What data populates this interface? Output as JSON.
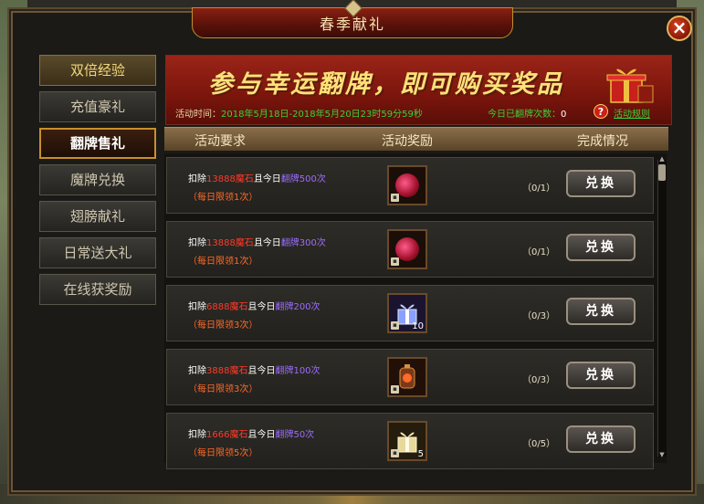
{
  "window": {
    "title": "春季献礼"
  },
  "sidebar": {
    "items": [
      {
        "label": "双倍经验",
        "style": "gold"
      },
      {
        "label": "充值豪礼",
        "style": "normal"
      },
      {
        "label": "翻牌售礼",
        "style": "active"
      },
      {
        "label": "魔牌兑换",
        "style": "normal"
      },
      {
        "label": "翅膀献礼",
        "style": "normal"
      },
      {
        "label": "日常送大礼",
        "style": "normal"
      },
      {
        "label": "在线获奖励",
        "style": "normal"
      }
    ]
  },
  "banner": {
    "title": "参与幸运翻牌，即可购买奖品",
    "time_label": "活动时间：",
    "time_value": "2018年5月18日-2018年5月20日23时59分59秒",
    "flip_label": "今日已翻牌次数：",
    "flip_value": "0",
    "rules_link": "活动规则"
  },
  "table": {
    "headers": [
      "活动要求",
      "活动奖励",
      "完成情况"
    ],
    "rows": [
      {
        "prefix": "扣除",
        "stone": "13888魔石",
        "mid": "且今日",
        "flip": "翻牌500次",
        "limit": "（每日限领1次）",
        "item": "red-orb",
        "qty": "",
        "progress": "（0/1）",
        "button": "兑换"
      },
      {
        "prefix": "扣除",
        "stone": "13888魔石",
        "mid": "且今日",
        "flip": "翻牌300次",
        "limit": "（每日限领1次）",
        "item": "red-orb",
        "qty": "",
        "progress": "（0/1）",
        "button": "兑换"
      },
      {
        "prefix": "扣除",
        "stone": "6888魔石",
        "mid": "且今日",
        "flip": "翻牌200次",
        "limit": "（每日限领3次）",
        "item": "blue-gift",
        "qty": "10",
        "progress": "（0/3）",
        "button": "兑换"
      },
      {
        "prefix": "扣除",
        "stone": "3888魔石",
        "mid": "且今日",
        "flip": "翻牌100次",
        "limit": "（每日限领3次）",
        "item": "lantern",
        "qty": "",
        "progress": "（0/3）",
        "button": "兑换"
      },
      {
        "prefix": "扣除",
        "stone": "1666魔石",
        "mid": "且今日",
        "flip": "翻牌50次",
        "limit": "（每日限领5次）",
        "item": "gold-gift",
        "qty": "5",
        "progress": "（0/5）",
        "button": "兑换"
      }
    ]
  },
  "colors": {
    "accent_red": "#ff3a2a",
    "accent_purple": "#9c6cff",
    "accent_green": "#38d23a",
    "limit_orange": "#ff6a2a"
  },
  "icons": {
    "close": "close-icon",
    "help": "help-icon",
    "gift": "gift-box-icon"
  }
}
